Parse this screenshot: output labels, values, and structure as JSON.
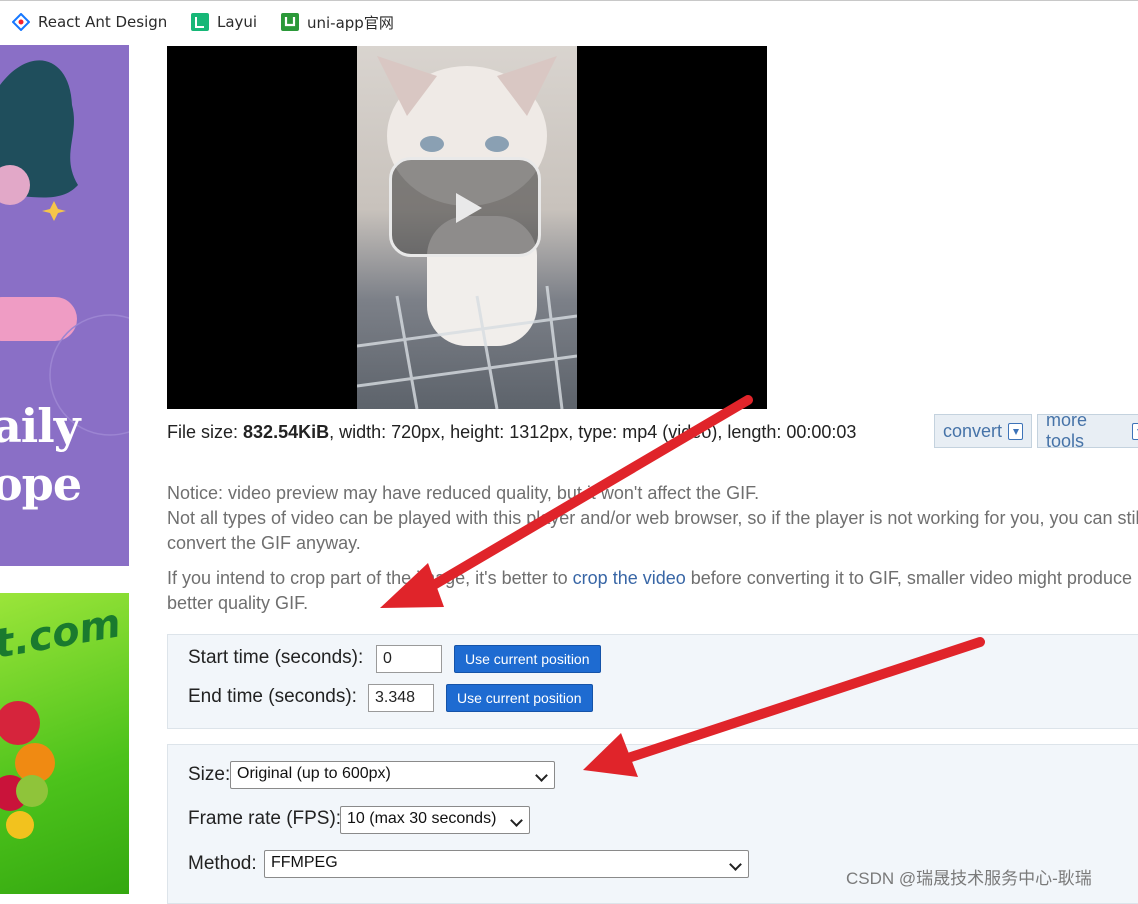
{
  "bookmarks": [
    {
      "label": "React Ant Design",
      "icon": "react-ant-design-icon"
    },
    {
      "label": "Layui",
      "icon": "layui-icon"
    },
    {
      "label": "uni-app官网",
      "icon": "uni-app-icon"
    }
  ],
  "ads": {
    "left_top_text": "aily\nope",
    "left_bottom_text": "t.com"
  },
  "file_info": {
    "file_size_label": "File size: ",
    "file_size_value": "832.54KiB",
    "rest": ", width: 720px, height: 1312px, type: mp4 (video), length: 00:00:03"
  },
  "tools": {
    "convert": "convert",
    "more_tools": "more tools"
  },
  "notice": {
    "line1": "Notice: video preview may have reduced quality, but it won't affect the GIF.",
    "line2": "Not all types of video can be played with this player and/or web browser, so if the player is not working for you, you can still convert the GIF anyway."
  },
  "crop": {
    "before": "If you intend to crop part of the image, it's better to ",
    "link": "crop the video",
    "after": " before converting it to GIF, smaller video might produce better quality GIF."
  },
  "times": {
    "start_label": "Start time (seconds):",
    "start_value": "0",
    "end_label": "End time (seconds):",
    "end_value": "3.348",
    "use_current_label": "Use current position"
  },
  "options": {
    "size_label": "Size:",
    "size_value": "Original (up to 600px)",
    "fps_label": "Frame rate (FPS):",
    "fps_value": "10 (max 30 seconds)",
    "method_label": "Method:",
    "method_value": "FFMPEG"
  },
  "watermark": "CSDN @瑞晟技术服务中心-耿瑞",
  "colors": {
    "accent_button": "#1e6bd1",
    "annotation_arrow": "#e0242a",
    "link": "#3866a6"
  }
}
